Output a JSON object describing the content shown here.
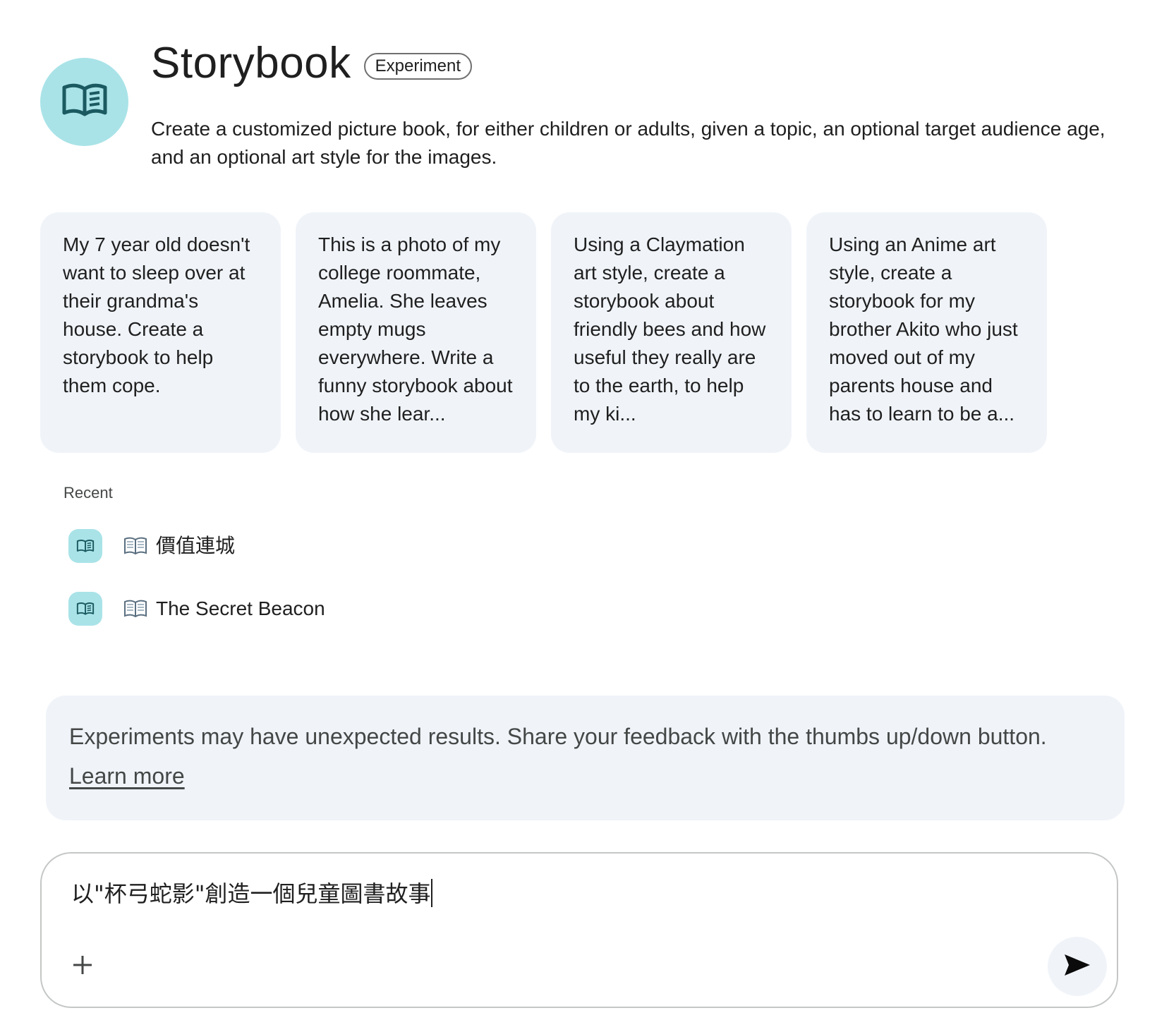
{
  "header": {
    "title": "Storybook",
    "badge": "Experiment",
    "description": "Create a customized picture book, for either children or adults, given a topic, an optional target audience age, and an optional art style for the images.",
    "avatar_icon": "open-book-icon"
  },
  "prompt_cards": [
    {
      "text": "My 7 year old doesn't want to sleep over at their grandma's house. Create a storybook to help them cope."
    },
    {
      "text": "This is a photo of my college roommate, Amelia. She leaves empty mugs everywhere. Write a funny storybook about how she lear..."
    },
    {
      "text": "Using a Claymation art style, create a storybook about friendly bees and how useful they really are to the earth, to help my ki..."
    },
    {
      "text": "Using an Anime art style, create a storybook for my brother Akito who just moved out of my parents house and has to learn to be a..."
    }
  ],
  "recent": {
    "label": "Recent",
    "items": [
      {
        "emoji": "📖",
        "title": "價值連城"
      },
      {
        "emoji": "📖",
        "title": "The Secret Beacon"
      }
    ]
  },
  "disclaimer": {
    "text": "Experiments may have unexpected results. Share your feedback with the thumbs up/down button.",
    "link": "Learn more"
  },
  "input": {
    "value": "以\"杯弓蛇影\"創造一個兒童圖書故事",
    "add_icon": "plus-icon",
    "send_icon": "send-arrow-icon"
  },
  "colors": {
    "accent_teal": "#a9e3e8",
    "card_background": "#f0f4f9",
    "icon_teal_dark": "#1a5a60"
  }
}
